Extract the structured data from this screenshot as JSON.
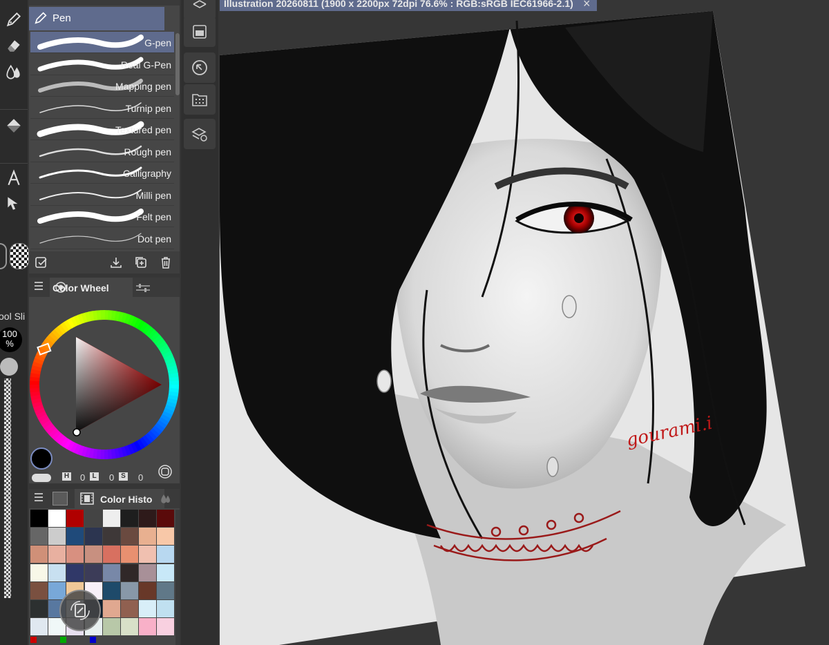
{
  "document": {
    "tab_title": "Illustration 20260811 (1900 x 2200px 72dpi 76.6% : RGB:sRGB IEC61966-2.1)",
    "close_glyph": "×"
  },
  "toolbar": {
    "tools": [
      "pen-icon",
      "eraser-icon",
      "blend-icon",
      "fill-icon",
      "text-icon",
      "operation-icon"
    ],
    "slider_label": "ool Sli",
    "slider_value": "100\n%",
    "slider_level": 1.0
  },
  "subtool": {
    "group_label": "Pen",
    "brushes": [
      {
        "name": "G-pen",
        "selected": true
      },
      {
        "name": "Real G-Pen",
        "selected": false
      },
      {
        "name": "Mapping pen",
        "selected": false
      },
      {
        "name": "Turnip pen",
        "selected": false
      },
      {
        "name": "Textured pen",
        "selected": false
      },
      {
        "name": "Rough pen",
        "selected": false
      },
      {
        "name": "Calligraphy",
        "selected": false
      },
      {
        "name": "Milli pen",
        "selected": false
      },
      {
        "name": "Felt pen",
        "selected": false
      },
      {
        "name": "Dot pen",
        "selected": false
      }
    ]
  },
  "color_wheel": {
    "title": "Color Wheel",
    "h_label": "H",
    "s_label": "S",
    "l_label": "L",
    "h_value": "0",
    "l_value": "0",
    "s_value": "0",
    "main_color": "#000000",
    "sub_color": "#ffffff"
  },
  "color_history": {
    "title": "Color Histo",
    "swatches": [
      "#000000",
      "#ffffff",
      "#b00000",
      "#444444",
      "#eeeeee",
      "#1e1e1e",
      "#2e1a1a",
      "#5a0a0a",
      "#666666",
      "#cccccc",
      "#1f4a7a",
      "#2c3550",
      "#3e3838",
      "#6a4a40",
      "#e8b090",
      "#f8c8a8",
      "#d09078",
      "#e8b0a0",
      "#d89080",
      "#c89080",
      "#d87060",
      "#e89070",
      "#f0c0b0",
      "#b8d8f0",
      "#f8f8e8",
      "#c8e0f0",
      "#303868",
      "#3c3c58",
      "#7888a8",
      "#302828",
      "#a89098",
      "#c8e8f8",
      "#7a5040",
      "#78a8d8",
      "#f0c898",
      "#f8f0f8",
      "#1e4a6a",
      "#8898a8",
      "#683828",
      "#607888",
      "#2c3030",
      "#5878a0",
      "#c8d0d8",
      "#102030",
      "#e0a890",
      "#906050",
      "#d8eef8",
      "#c0e0f0",
      "#e0e8f0",
      "#f0f8f8",
      "#e8e0f0",
      "#e8f0f0",
      "#b8c8a8",
      "#d8e0c8",
      "#f8b0c8",
      "#f8d0e0"
    ],
    "footer_marks": [
      "#cc0000",
      "#00aa00",
      "#0000cc"
    ]
  },
  "signature": "gourami.i"
}
